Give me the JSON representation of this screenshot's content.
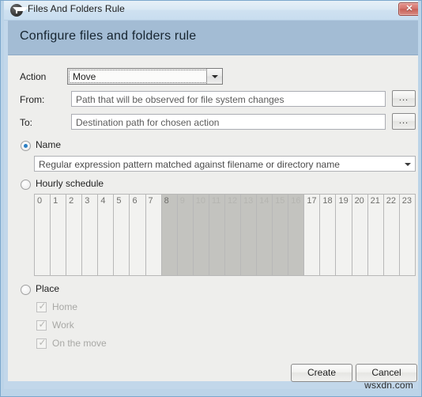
{
  "window": {
    "title": "Files And Folders Rule",
    "icon": "funnel-icon",
    "close_label": "✕"
  },
  "header": {
    "title": "Configure files and folders rule"
  },
  "form": {
    "action": {
      "label": "Action",
      "value": "Move"
    },
    "from": {
      "label": "From:",
      "value": "",
      "placeholder": "Path that will be observed for file system changes",
      "browse_label": "..."
    },
    "to": {
      "label": "To:",
      "value": "",
      "placeholder": "Destination path for chosen action",
      "browse_label": "..."
    },
    "condition_group": {
      "name_option": {
        "label": "Name",
        "selected": true
      },
      "name_pattern": {
        "value": "",
        "placeholder": "Regular expression pattern matched against filename or directory name"
      },
      "hourly_option": {
        "label": "Hourly schedule",
        "selected": false
      },
      "hours": [
        {
          "hour": "0",
          "selected": false
        },
        {
          "hour": "1",
          "selected": false
        },
        {
          "hour": "2",
          "selected": false
        },
        {
          "hour": "3",
          "selected": false
        },
        {
          "hour": "4",
          "selected": false
        },
        {
          "hour": "5",
          "selected": false
        },
        {
          "hour": "6",
          "selected": false
        },
        {
          "hour": "7",
          "selected": false
        },
        {
          "hour": "8",
          "selected": true
        },
        {
          "hour": "9",
          "selected": true
        },
        {
          "hour": "10",
          "selected": true
        },
        {
          "hour": "11",
          "selected": true
        },
        {
          "hour": "12",
          "selected": true
        },
        {
          "hour": "13",
          "selected": true
        },
        {
          "hour": "14",
          "selected": true
        },
        {
          "hour": "15",
          "selected": true
        },
        {
          "hour": "16",
          "selected": true
        },
        {
          "hour": "17",
          "selected": false
        },
        {
          "hour": "18",
          "selected": false
        },
        {
          "hour": "19",
          "selected": false
        },
        {
          "hour": "20",
          "selected": false
        },
        {
          "hour": "21",
          "selected": false
        },
        {
          "hour": "22",
          "selected": false
        },
        {
          "hour": "23",
          "selected": false
        }
      ],
      "place_option": {
        "label": "Place",
        "selected": false
      },
      "places": [
        {
          "label": "Home",
          "checked": true,
          "enabled": false
        },
        {
          "label": "Work",
          "checked": true,
          "enabled": false
        },
        {
          "label": "On the move",
          "checked": true,
          "enabled": false
        }
      ],
      "check_glyph": "✓"
    }
  },
  "footer": {
    "create_label": "Create",
    "cancel_label": "Cancel"
  },
  "watermark": "wsxdn.com",
  "colors": {
    "header_band": "#a3bcd4",
    "frame": "#bcd4e8",
    "content_bg": "#eeeeec",
    "radio_dot": "#2b7fc4",
    "hour_selected": "#c3c3bf",
    "close_button": "#c75f56"
  }
}
